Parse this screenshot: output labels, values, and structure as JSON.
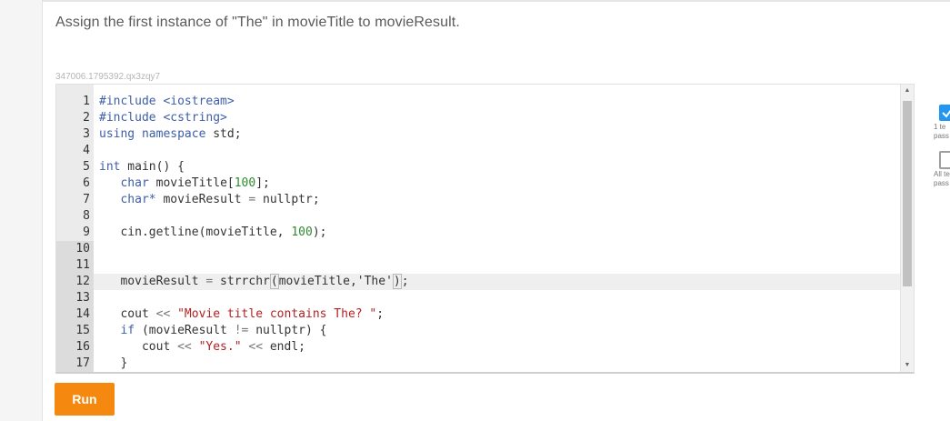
{
  "instruction": "Assign the first instance of \"The\" in movieTitle to movieResult.",
  "problem_id": "347006.1795392.qx3zqy7",
  "editor": {
    "lines": [
      {
        "num": "1",
        "tokens": [
          {
            "t": "#include <iostream>",
            "c": "dir"
          }
        ]
      },
      {
        "num": "2",
        "tokens": [
          {
            "t": "#include <cstring>",
            "c": "dir"
          }
        ]
      },
      {
        "num": "3",
        "tokens": [
          {
            "t": "using namespace",
            "c": "kw"
          },
          {
            "t": " std;",
            "c": ""
          }
        ]
      },
      {
        "num": "4",
        "tokens": []
      },
      {
        "num": "5",
        "tokens": [
          {
            "t": "int",
            "c": "type"
          },
          {
            "t": " main() {",
            "c": ""
          }
        ]
      },
      {
        "num": "6",
        "tokens": [
          {
            "t": "   char",
            "c": "type"
          },
          {
            "t": " movieTitle[",
            "c": ""
          },
          {
            "t": "100",
            "c": "num"
          },
          {
            "t": "];",
            "c": ""
          }
        ]
      },
      {
        "num": "7",
        "tokens": [
          {
            "t": "   char*",
            "c": "type"
          },
          {
            "t": " movieResult ",
            "c": ""
          },
          {
            "t": "=",
            "c": "op"
          },
          {
            "t": " nullptr;",
            "c": ""
          }
        ]
      },
      {
        "num": "8",
        "tokens": []
      },
      {
        "num": "9",
        "tokens": [
          {
            "t": "   cin.getline(movieTitle, ",
            "c": ""
          },
          {
            "t": "100",
            "c": "num"
          },
          {
            "t": ");",
            "c": ""
          }
        ]
      },
      {
        "num": "10",
        "tokens": []
      },
      {
        "num": "11",
        "tokens": []
      },
      {
        "num": "12",
        "tokens": [
          {
            "t": "   movieResult ",
            "c": ""
          },
          {
            "t": "=",
            "c": "op"
          },
          {
            "t": " strrchr",
            "c": ""
          },
          {
            "t": "(",
            "c": "paren"
          },
          {
            "t": "movieTitle,'The'",
            "c": ""
          },
          {
            "t": ")",
            "c": "paren"
          },
          {
            "t": ";",
            "c": ""
          }
        ]
      },
      {
        "num": "13",
        "tokens": []
      },
      {
        "num": "14",
        "tokens": [
          {
            "t": "   cout ",
            "c": ""
          },
          {
            "t": "<<",
            "c": "op"
          },
          {
            "t": " \"Movie title contains The? \"",
            "c": "str"
          },
          {
            "t": ";",
            "c": ""
          }
        ]
      },
      {
        "num": "15",
        "tokens": [
          {
            "t": "   if",
            "c": "kw"
          },
          {
            "t": " (movieResult ",
            "c": ""
          },
          {
            "t": "!=",
            "c": "op"
          },
          {
            "t": " nullptr) {",
            "c": ""
          }
        ]
      },
      {
        "num": "16",
        "tokens": [
          {
            "t": "      cout ",
            "c": ""
          },
          {
            "t": "<<",
            "c": "op"
          },
          {
            "t": " \"Yes.\"",
            "c": "str"
          },
          {
            "t": " ",
            "c": ""
          },
          {
            "t": "<<",
            "c": "op"
          },
          {
            "t": " endl;",
            "c": ""
          }
        ]
      },
      {
        "num": "17",
        "tokens": [
          {
            "t": "   }",
            "c": ""
          }
        ]
      }
    ]
  },
  "run_label": "Run",
  "status": {
    "test1_line1": "1 te",
    "test1_line2": "pass",
    "test2_line1": "All te",
    "test2_line2": "pass"
  },
  "colors": {
    "run_button": "#f5890f",
    "check_box": "#2196f3",
    "keyword": "#3d5ea8",
    "number": "#2e8b2e",
    "string": "#b22222"
  }
}
